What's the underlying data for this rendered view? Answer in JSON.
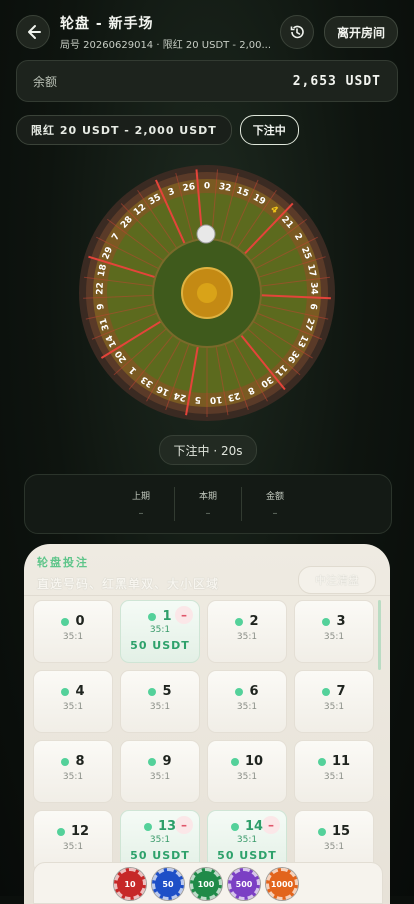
{
  "header": {
    "back_icon": "back-arrow-icon",
    "title": "轮盘 - 新手场",
    "subtitle": "局号 20260629014 · 限红 20 USDT - 2,00...",
    "history_icon": "history-icon",
    "leave_label": "离开房间"
  },
  "balance": {
    "label": "余额",
    "value": "2,653 USDT"
  },
  "limits": {
    "range": "限红 20 USDT - 2,000 USDT",
    "status_label": "下注中"
  },
  "wheel": {
    "numbers": [
      "0",
      "32",
      "15",
      "19",
      "4",
      "21",
      "2",
      "25",
      "17",
      "34",
      "6",
      "27",
      "13",
      "36",
      "11",
      "30",
      "8",
      "23",
      "10",
      "5",
      "24",
      "16",
      "33",
      "1",
      "20",
      "14",
      "31",
      "9",
      "22",
      "18",
      "29",
      "7",
      "28",
      "12",
      "35",
      "3",
      "26"
    ],
    "highlight_number": "4",
    "colors": {
      "red": "#c0392b",
      "black": "#1c1c1c",
      "green": "#2e7d32",
      "gold": "#d4a017"
    }
  },
  "status_pill": "下注中 · 20s",
  "stats": [
    {
      "label": "上期",
      "value": "–"
    },
    {
      "label": "本期",
      "value": "–"
    },
    {
      "label": "金额",
      "value": "–"
    }
  ],
  "bet_panel": {
    "title": "轮盘投注",
    "subtitle": "直选号码、红黑单双、大小区域",
    "clear_label": "中注清盘",
    "cells": [
      {
        "number": "0",
        "odds": "35:1",
        "amount": ""
      },
      {
        "number": "1",
        "odds": "35:1",
        "amount": "50 USDT"
      },
      {
        "number": "2",
        "odds": "35:1",
        "amount": ""
      },
      {
        "number": "3",
        "odds": "35:1",
        "amount": ""
      },
      {
        "number": "4",
        "odds": "35:1",
        "amount": ""
      },
      {
        "number": "5",
        "odds": "35:1",
        "amount": ""
      },
      {
        "number": "6",
        "odds": "35:1",
        "amount": ""
      },
      {
        "number": "7",
        "odds": "35:1",
        "amount": ""
      },
      {
        "number": "8",
        "odds": "35:1",
        "amount": ""
      },
      {
        "number": "9",
        "odds": "35:1",
        "amount": ""
      },
      {
        "number": "10",
        "odds": "35:1",
        "amount": ""
      },
      {
        "number": "11",
        "odds": "35:1",
        "amount": ""
      },
      {
        "number": "12",
        "odds": "35:1",
        "amount": ""
      },
      {
        "number": "13",
        "odds": "35:1",
        "amount": "50 USDT"
      },
      {
        "number": "14",
        "odds": "35:1",
        "amount": "50 USDT"
      },
      {
        "number": "15",
        "odds": "35:1",
        "amount": ""
      }
    ],
    "remove_symbol": "–",
    "accent": "#54d19a"
  },
  "chips": [
    {
      "label": "10",
      "color": "#c62828"
    },
    {
      "label": "50",
      "color": "#1e4fc7"
    },
    {
      "label": "100",
      "color": "#1f8a48"
    },
    {
      "label": "500",
      "color": "#7b3fc4"
    },
    {
      "label": "1000",
      "color": "#e2641c"
    }
  ]
}
